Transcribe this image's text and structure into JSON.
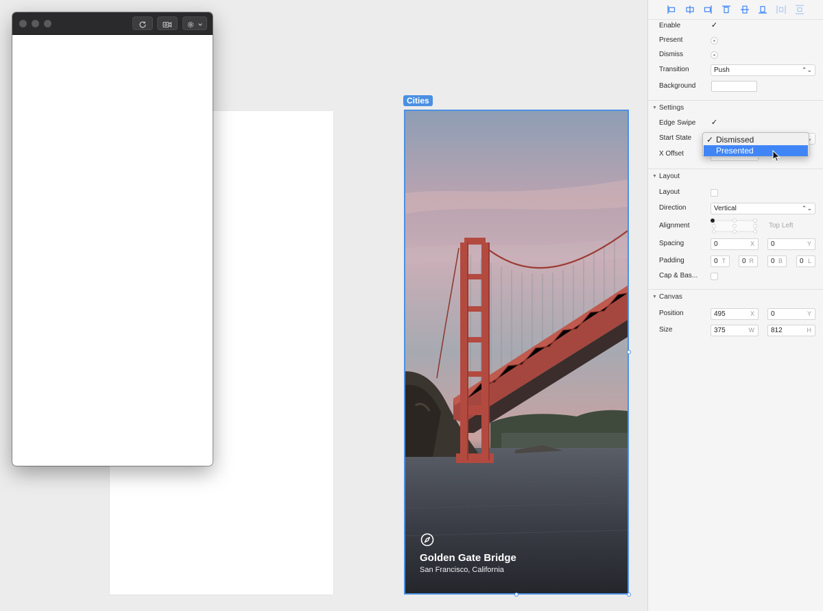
{
  "artboard": {
    "label": "Cities"
  },
  "card": {
    "title": "Golden Gate Bridge",
    "subtitle": "San Francisco, California"
  },
  "inspector": {
    "interaction": {
      "enable_label": "Enable",
      "present_label": "Present",
      "dismiss_label": "Dismiss",
      "transition_label": "Transition",
      "transition_value": "Push",
      "background_label": "Background"
    },
    "settings": {
      "title": "Settings",
      "edge_swipe_label": "Edge Swipe",
      "start_state_label": "Start State",
      "x_offset_label": "X Offset",
      "menu": {
        "options": [
          "Dismissed",
          "Presented"
        ],
        "selected": "Dismissed",
        "highlighted": "Presented"
      }
    },
    "layout": {
      "title": "Layout",
      "layout_label": "Layout",
      "direction_label": "Direction",
      "direction_value": "Vertical",
      "alignment_label": "Alignment",
      "alignment_value": "Top Left",
      "spacing_label": "Spacing",
      "spacing_x": "0",
      "spacing_y": "0",
      "padding_label": "Padding",
      "padding_t": "0",
      "padding_r": "0",
      "padding_b": "0",
      "padding_l": "0",
      "cap_label": "Cap & Bas..."
    },
    "canvas": {
      "title": "Canvas",
      "position_label": "Position",
      "position_x": "495",
      "position_y": "0",
      "size_label": "Size",
      "size_w": "375",
      "size_h": "812"
    },
    "units": {
      "x": "X",
      "y": "Y",
      "t": "T",
      "r": "R",
      "b": "B",
      "l": "L",
      "w": "W",
      "h": "H"
    }
  },
  "colors": {
    "accent": "#4a90e2",
    "menu_highlight": "#3f85f6"
  }
}
